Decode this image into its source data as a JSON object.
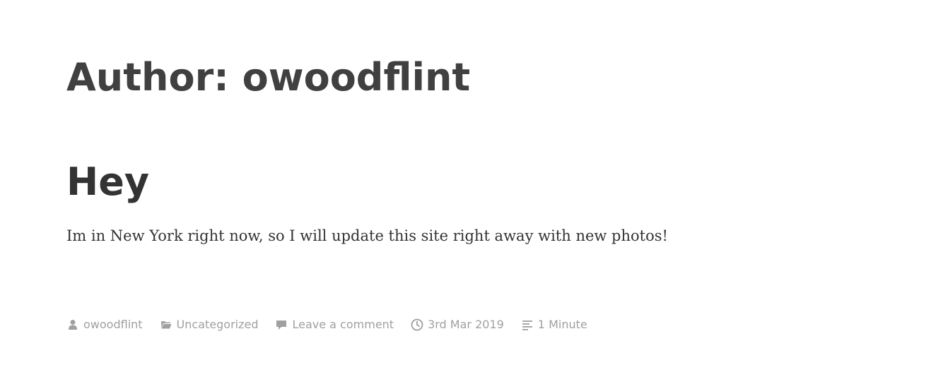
{
  "archive": {
    "title": "Author: owoodflint"
  },
  "post": {
    "title": "Hey",
    "content": "Im in New York right now, so I will update this site right away with new photos!"
  },
  "meta": {
    "author": {
      "icon": "person-icon",
      "label": "owoodflint"
    },
    "category": {
      "icon": "folder-icon",
      "label": "Uncategorized"
    },
    "comments": {
      "icon": "comment-icon",
      "label": "Leave a comment"
    },
    "date": {
      "icon": "clock-icon",
      "label": "3rd Mar 2019"
    },
    "reading_time": {
      "icon": "lines-icon",
      "label": "1 Minute"
    }
  },
  "colors": {
    "heading": "#404040",
    "text": "#333333",
    "meta": "#a0a0a0",
    "background": "#ffffff"
  }
}
